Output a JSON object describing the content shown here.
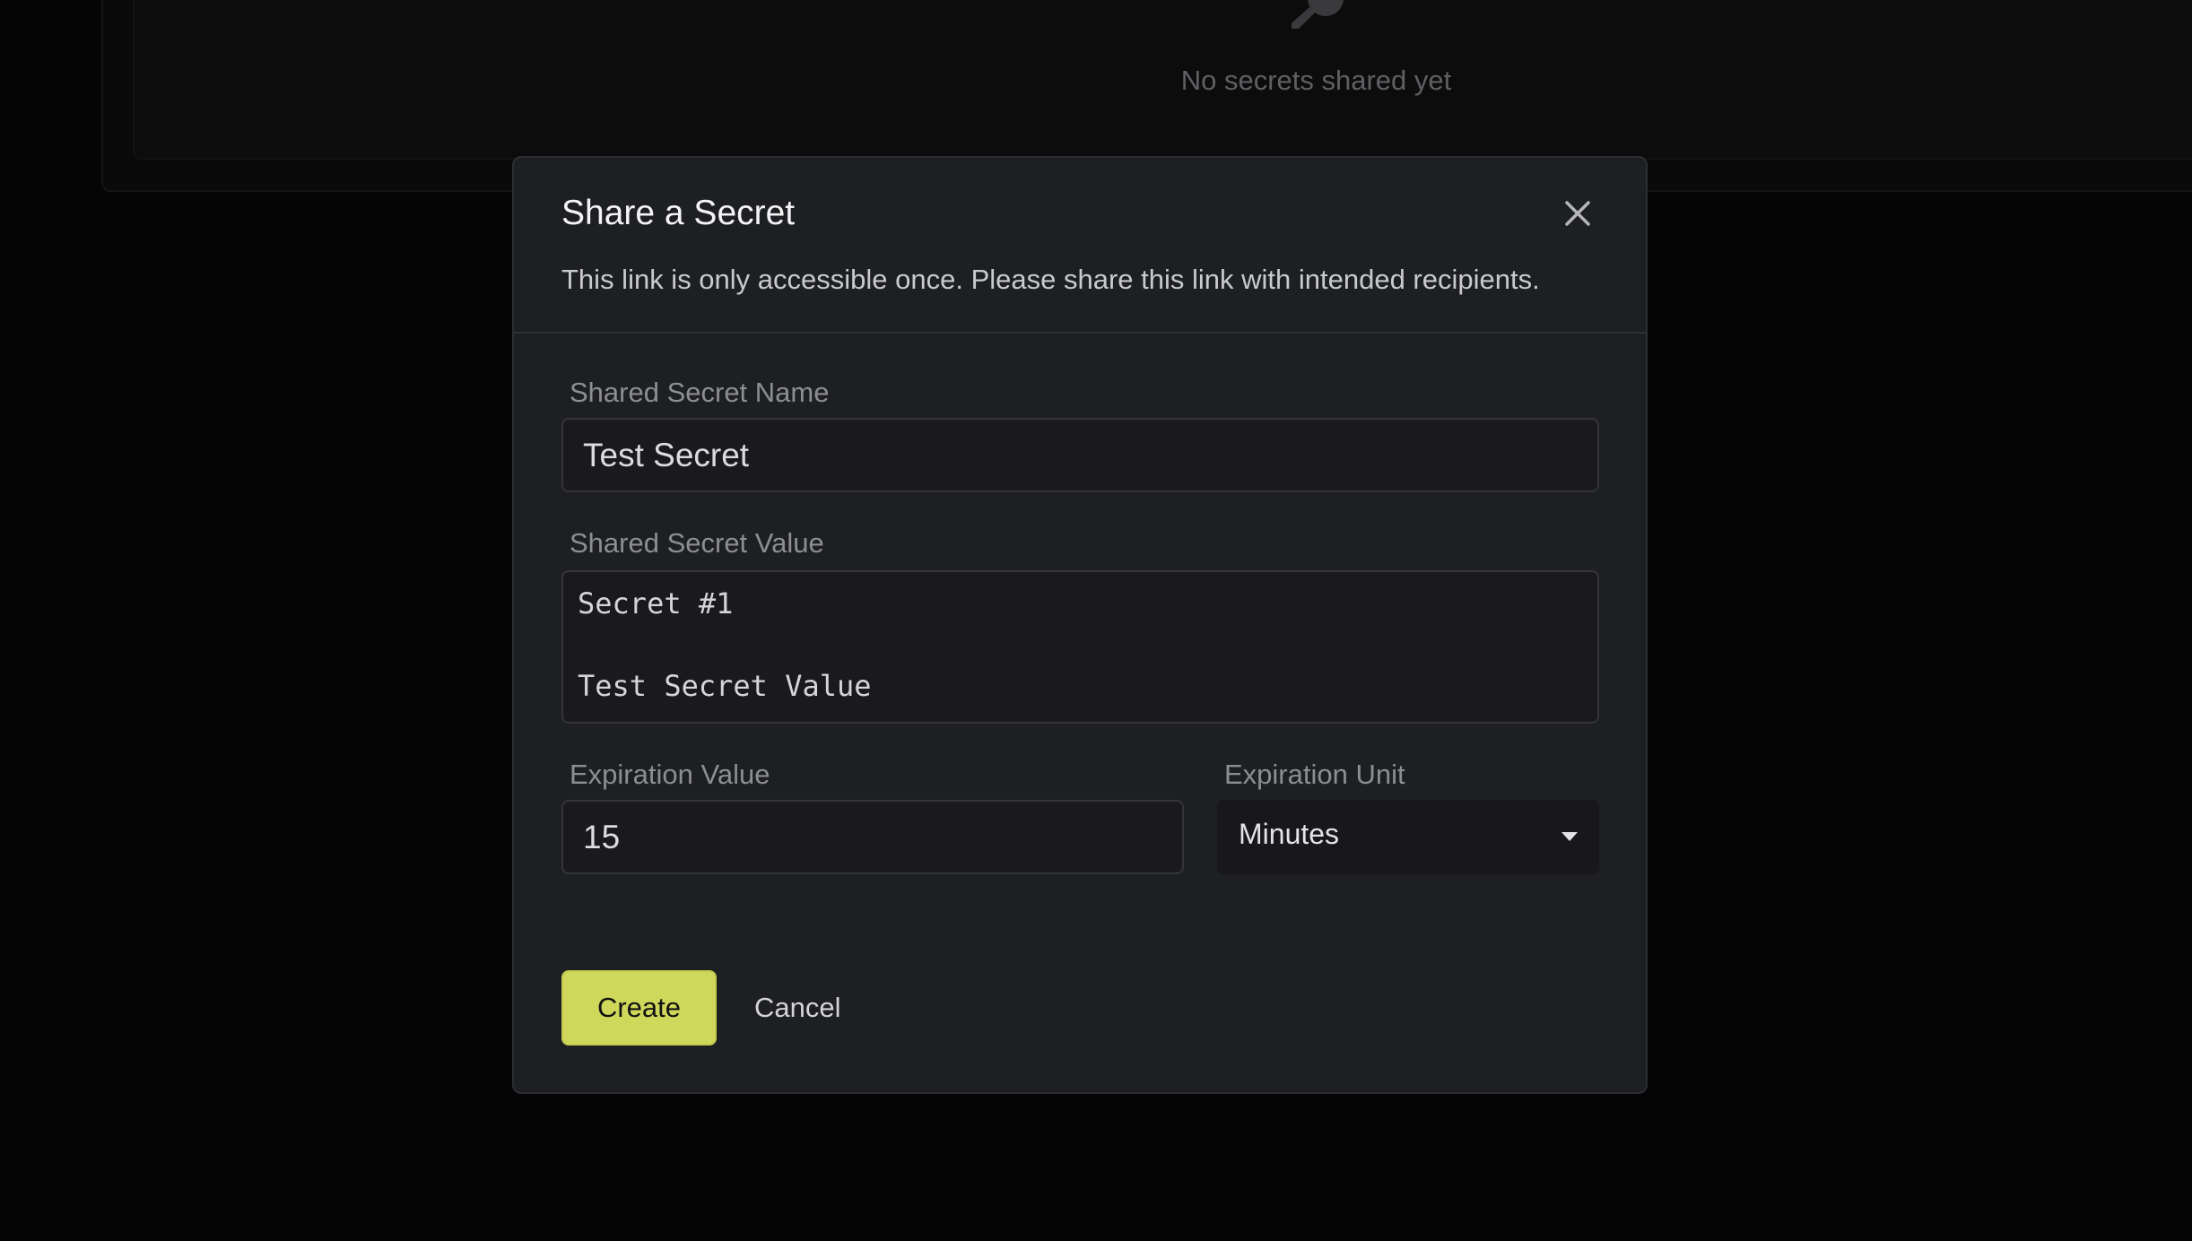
{
  "background": {
    "empty_state_text": "No secrets shared yet",
    "empty_state_icon": "key-icon"
  },
  "modal": {
    "title": "Share a Secret",
    "subtitle": "This link is only accessible once. Please share this link with intended recipients.",
    "close_icon": "close-icon",
    "fields": {
      "name": {
        "label": "Shared Secret Name",
        "value": "Test Secret"
      },
      "value": {
        "label": "Shared Secret Value",
        "value": "Secret #1\n\nTest Secret Value"
      },
      "expiration_value": {
        "label": "Expiration Value",
        "value": "15"
      },
      "expiration_unit": {
        "label": "Expiration Unit",
        "selected": "Minutes"
      }
    },
    "buttons": {
      "create_label": "Create",
      "cancel_label": "Cancel"
    }
  },
  "colors": {
    "accent": "#cfd85a",
    "modal_bg": "#1e1f22",
    "page_bg": "#050506"
  }
}
